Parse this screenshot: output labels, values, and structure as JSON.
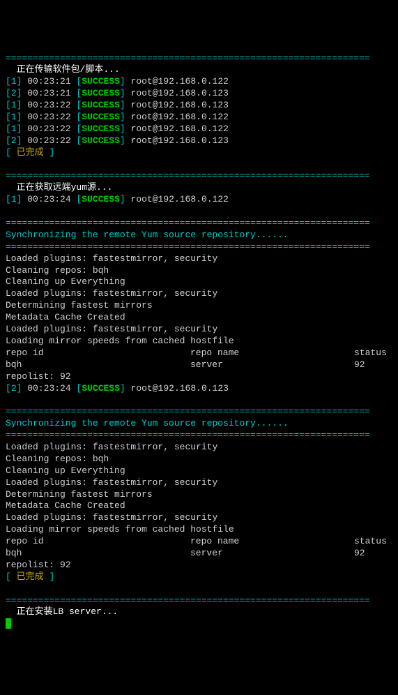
{
  "divider": "===================================================================",
  "section1": {
    "title": "  正在传输软件包/脚本...",
    "lines": [
      {
        "idx": "1",
        "time": "00:23:21",
        "status": "SUCCESS",
        "target": "root@192.168.0.122"
      },
      {
        "idx": "2",
        "time": "00:23:21",
        "status": "SUCCESS",
        "target": "root@192.168.0.123"
      },
      {
        "idx": "1",
        "time": "00:23:22",
        "status": "SUCCESS",
        "target": "root@192.168.0.123"
      },
      {
        "idx": "1",
        "time": "00:23:22",
        "status": "SUCCESS",
        "target": "root@192.168.0.122"
      },
      {
        "idx": "1",
        "time": "00:23:22",
        "status": "SUCCESS",
        "target": "root@192.168.0.122"
      },
      {
        "idx": "2",
        "time": "00:23:22",
        "status": "SUCCESS",
        "target": "root@192.168.0.123"
      }
    ],
    "done": "已完成"
  },
  "section2": {
    "title": "  正在获取远端yum源...",
    "line1": {
      "idx": "1",
      "time": "00:23:24",
      "status": "SUCCESS",
      "target": "root@192.168.0.122"
    },
    "sync_header": "Synchronizing the remote Yum source repository......",
    "output": [
      "Loaded plugins: fastestmirror, security",
      "Cleaning repos: bqh",
      "Cleaning up Everything",
      "Loaded plugins: fastestmirror, security",
      "Determining fastest mirrors",
      "Metadata Cache Created",
      "Loaded plugins: fastestmirror, security",
      "Loading mirror speeds from cached hostfile"
    ],
    "repo_header": {
      "c1": "repo id",
      "c2": "repo name",
      "c3": "status"
    },
    "repo_row": {
      "c1": "bqh",
      "c2": "server",
      "c3": "92"
    },
    "repolist": "repolist: 92",
    "line2": {
      "idx": "2",
      "time": "00:23:24",
      "status": "SUCCESS",
      "target": "root@192.168.0.123"
    },
    "sync_header2": "Synchronizing the remote Yum source repository......",
    "output2": [
      "Loaded plugins: fastestmirror, security",
      "Cleaning repos: bqh",
      "Cleaning up Everything",
      "Loaded plugins: fastestmirror, security",
      "Determining fastest mirrors",
      "Metadata Cache Created",
      "Loaded plugins: fastestmirror, security",
      "Loading mirror speeds from cached hostfile"
    ],
    "repo_header2": {
      "c1": "repo id",
      "c2": "repo name",
      "c3": "status"
    },
    "repo_row2": {
      "c1": "bqh",
      "c2": "server",
      "c3": "92"
    },
    "repolist2": "repolist: 92",
    "done": "已完成"
  },
  "section3": {
    "title": "  正在安装LB server..."
  },
  "brackets": {
    "open": "[",
    "close": "]"
  }
}
